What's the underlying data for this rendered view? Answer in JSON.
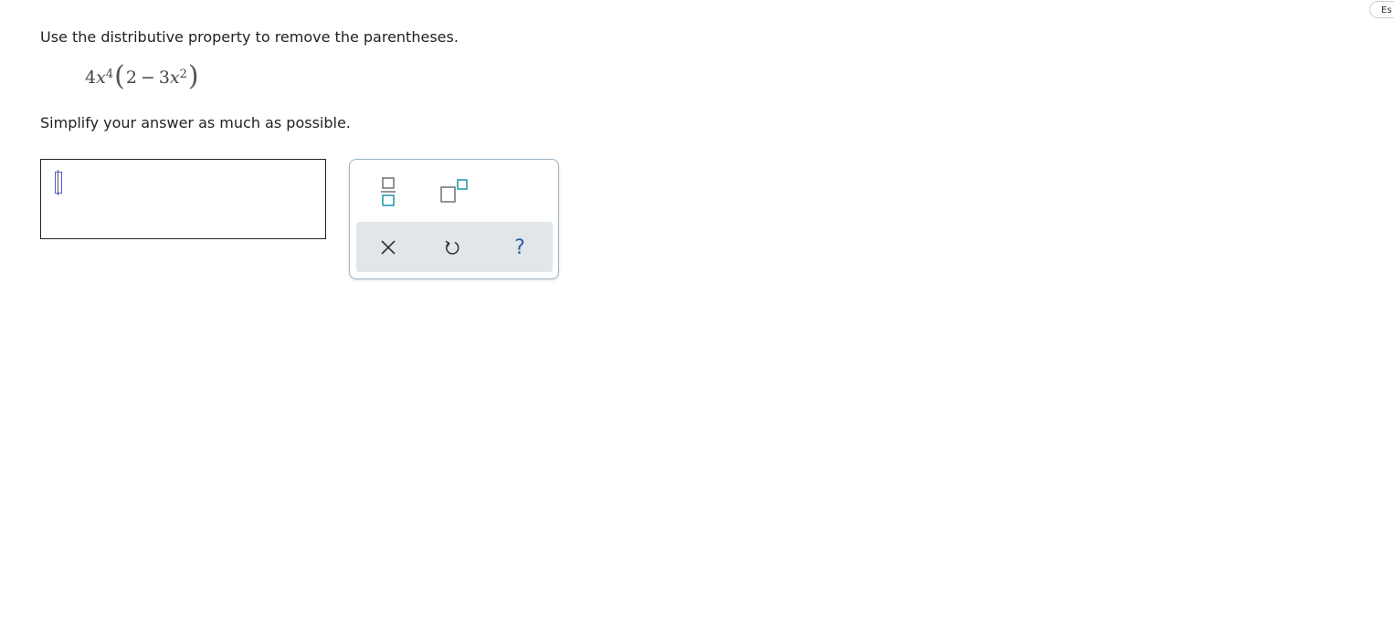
{
  "header": {
    "language_button": "Es"
  },
  "question": {
    "instruction": "Use the distributive property to remove the parentheses.",
    "expression": {
      "coefficient": "4",
      "variable": "x",
      "exponent": "4",
      "inner_constant": "2",
      "operator": "−",
      "inner_coefficient": "3",
      "inner_variable": "x",
      "inner_exponent": "2"
    },
    "simplify_note": "Simplify your answer as much as possible."
  },
  "answer": {
    "value": ""
  },
  "palette": {
    "tools": [
      "fraction-template",
      "exponent-template"
    ],
    "actions": {
      "help_label": "?"
    }
  },
  "colors": {
    "template_teal": "#2a9bb0",
    "template_gray": "#666666",
    "help_blue": "#2a5fa8",
    "action_bar": "#e1e6e9",
    "palette_border": "#9fb5c4",
    "caret_blue": "#4a5bd6"
  }
}
